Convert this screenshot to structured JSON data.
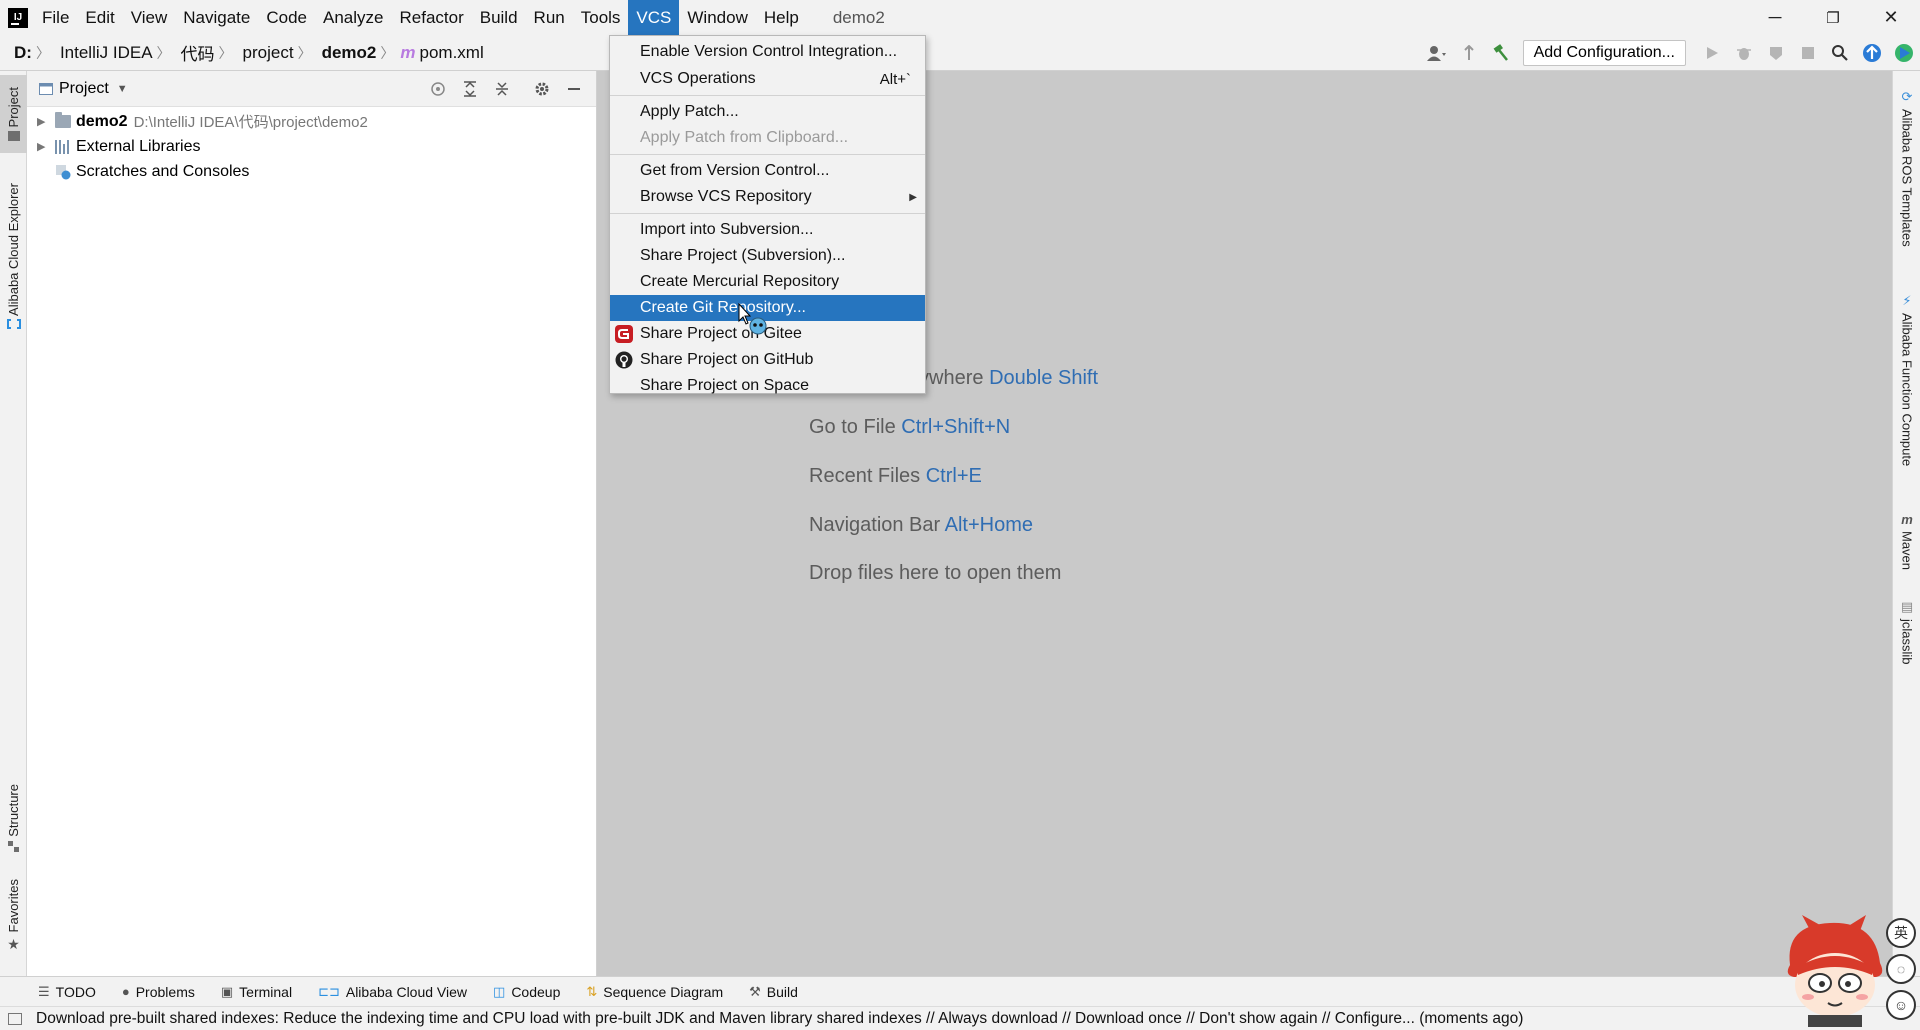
{
  "titlebar": {
    "menus": [
      "File",
      "Edit",
      "View",
      "Navigate",
      "Code",
      "Analyze",
      "Refactor",
      "Build",
      "Run",
      "Tools",
      "VCS",
      "Window",
      "Help"
    ],
    "active_menu": "VCS",
    "window_title": "demo2",
    "controls": {
      "minimize": "─",
      "restore": "❐",
      "close": "✕"
    }
  },
  "navbar": {
    "crumbs": [
      "D:",
      "IntelliJ IDEA",
      "代码",
      "project",
      "demo2"
    ],
    "file": "pom.xml",
    "file_icon": "m",
    "add_configuration": "Add Configuration..."
  },
  "left_stripe": {
    "tabs": [
      "Project",
      "Alibaba Cloud Explorer",
      "Structure",
      "Favorites"
    ]
  },
  "project_panel": {
    "title": "Project",
    "tree": [
      {
        "name": "demo2",
        "path": "D:\\IntelliJ IDEA\\代码\\project\\demo2",
        "icon": "folder-icon"
      },
      {
        "name": "External Libraries",
        "icon": "libraries-icon"
      },
      {
        "name": "Scratches and Consoles",
        "icon": "scratches-icon"
      }
    ]
  },
  "editor": {
    "hints": [
      {
        "text": "Search Everywhere ",
        "key": "Double Shift"
      },
      {
        "text": "Go to File ",
        "key": "Ctrl+Shift+N"
      },
      {
        "text": "Recent Files ",
        "key": "Ctrl+E"
      },
      {
        "text": "Navigation Bar ",
        "key": "Alt+Home"
      },
      {
        "text": "Drop files here to open them",
        "key": ""
      }
    ]
  },
  "vcs_menu": {
    "items": [
      {
        "label": "Enable Version Control Integration..."
      },
      {
        "label": "VCS Operations",
        "shortcut": "Alt+`"
      },
      {
        "label": "Apply Patch..."
      },
      {
        "label": "Apply Patch from Clipboard...",
        "disabled": true
      },
      {
        "label": "Get from Version Control..."
      },
      {
        "label": "Browse VCS Repository",
        "submenu": true
      },
      {
        "label": "Import into Subversion..."
      },
      {
        "label": "Share Project (Subversion)..."
      },
      {
        "label": "Create Mercurial Repository"
      },
      {
        "label": "Create Git Repository...",
        "selected": true
      },
      {
        "label": "Share Project on Gitee",
        "icon": "gitee-icon"
      },
      {
        "label": "Share Project on GitHub",
        "icon": "github-icon"
      },
      {
        "label": "Share Project on Space"
      }
    ]
  },
  "right_stripe": {
    "tabs": [
      "Alibaba ROS Templates",
      "Alibaba Function Compute",
      "Maven",
      "jclasslib"
    ]
  },
  "bottom_bar": {
    "tabs": [
      "TODO",
      "Problems",
      "Terminal",
      "Alibaba Cloud View",
      "Codeup",
      "Sequence Diagram",
      "Build"
    ]
  },
  "status_bar": {
    "message": "Download pre-built shared indexes: Reduce the indexing time and CPU load with pre-built JDK and Maven library shared indexes // Always download // Download once // Don't show again // Configure... (moments ago)"
  },
  "ime": {
    "label": "英"
  },
  "colors": {
    "accent": "#2675bf",
    "editor_bg": "#c9c9c9",
    "shortcut_blue": "#2f6db3",
    "gitee_red": "#c71d23"
  }
}
